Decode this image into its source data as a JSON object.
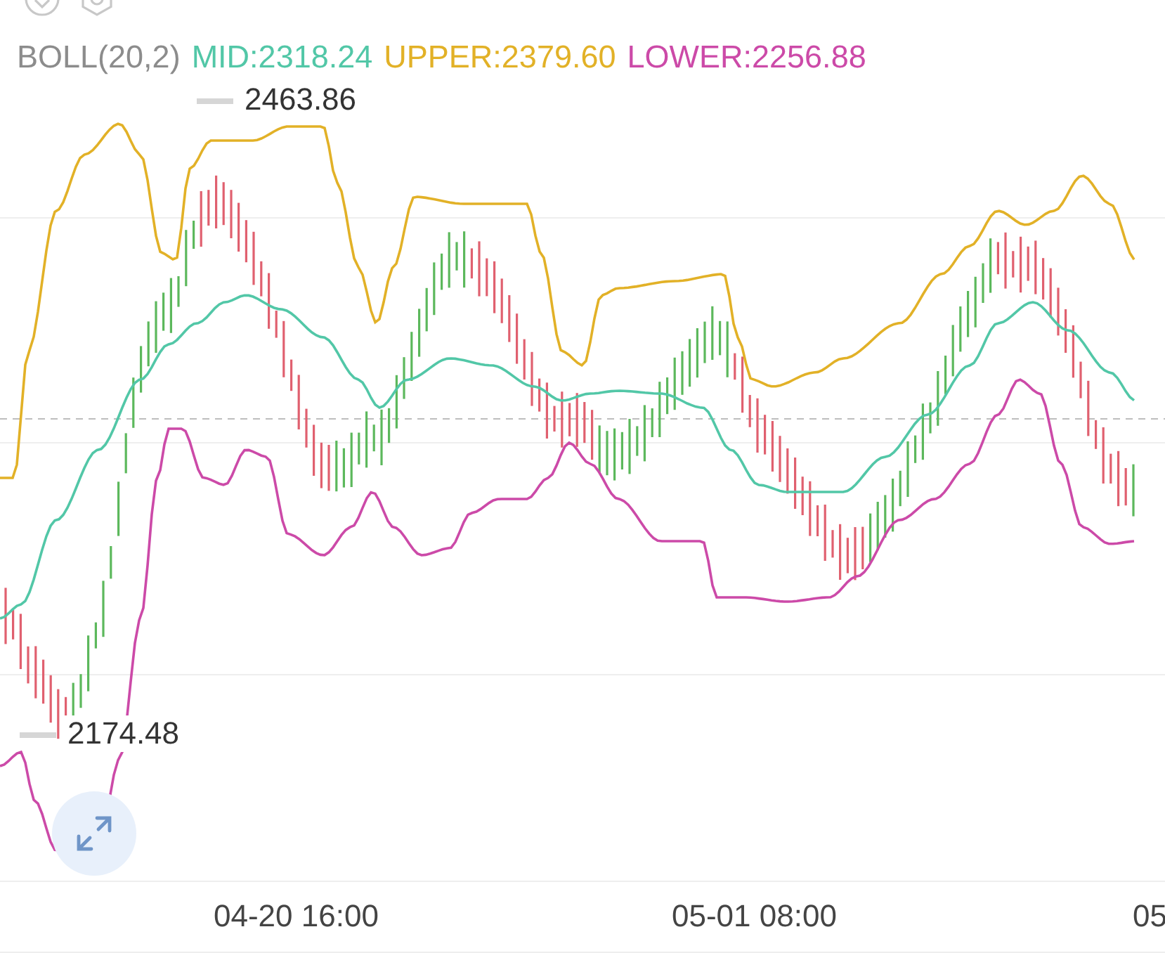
{
  "legend": [
    {
      "text": "BOLL(20,2)",
      "color": "#8c8c8c"
    },
    {
      "text": "MID:2318.24",
      "color": "#52c7a7"
    },
    {
      "text": "UPPER:2379.60",
      "color": "#e2b127"
    },
    {
      "text": "LOWER:2256.88",
      "color": "#cc4aa8"
    }
  ],
  "chart": {
    "max_label": "2463.86",
    "min_label": "2174.48"
  },
  "time_axis": [
    "04-20 16:00",
    "05-01 08:00",
    "05"
  ]
}
